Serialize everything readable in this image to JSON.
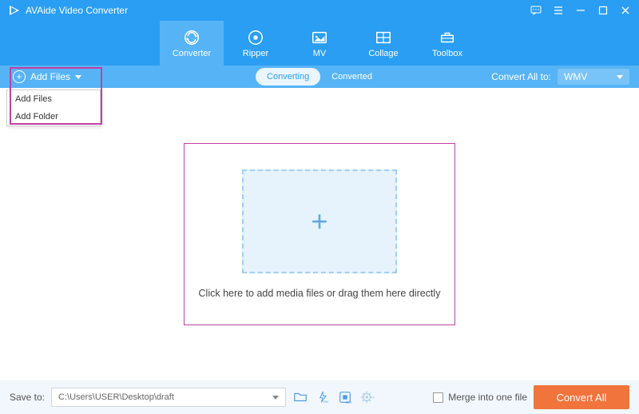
{
  "title_bar": {
    "app_name": "AVAide Video Converter"
  },
  "tabs": [
    {
      "label": "Converter",
      "active": true
    },
    {
      "label": "Ripper",
      "active": false
    },
    {
      "label": "MV",
      "active": false
    },
    {
      "label": "Collage",
      "active": false
    },
    {
      "label": "Toolbox",
      "active": false
    }
  ],
  "sub_bar": {
    "add_files_label": "Add Files",
    "pill_converting": "Converting",
    "pill_converted": "Converted",
    "convert_all_label": "Convert All to:",
    "selected_format": "WMV"
  },
  "dropdown": {
    "item_add_files": "Add Files",
    "item_add_folder": "Add Folder"
  },
  "main": {
    "drop_text": "Click here to add media files or drag them here directly"
  },
  "bottom": {
    "save_to_label": "Save to:",
    "save_path": "C:\\Users\\USER\\Desktop\\draft",
    "merge_label": "Merge into one file",
    "convert_button": "Convert All"
  }
}
